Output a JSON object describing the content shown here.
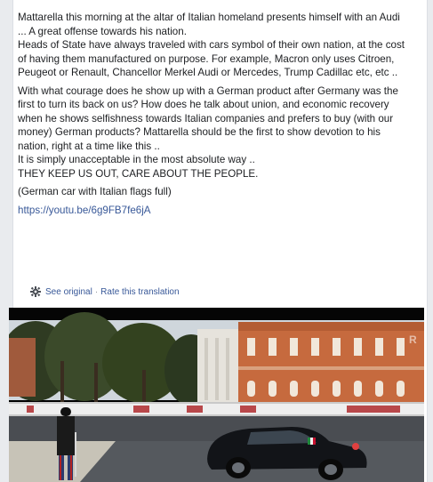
{
  "post": {
    "paragraphs": [
      "Mattarella this morning at the altar of Italian homeland presents himself with an Audi ... A great offense towards his nation.\nHeads of State have always traveled with cars symbol of their own nation, at the cost of having them manufactured on purpose. For example, Macron only uses Citroen, Peugeot or Renault, Chancellor Merkel Audi or Mercedes, Trump Cadillac etc, etc ..",
      "With what courage does he show up with a German product after Germany was the first to turn its back on us? How does he talk about union, and economic recovery when he shows selfishness towards Italian companies and prefers to buy (with our money) German products? Mattarella should be the first to show devotion to his nation, right at a time like this ..\nIt is simply unacceptable in the most absolute way ..\nTHEY KEEP US OUT, CARE ABOUT THE PEOPLE.",
      "(German car with Italian flags full)"
    ],
    "link": "https://youtu.be/6g9FB7fe6jA"
  },
  "translation": {
    "see_original": "See original",
    "separator": "·",
    "rate": "Rate this translation",
    "icon": "gear-icon"
  },
  "media": {
    "description_icon": "video-thumbnail",
    "colors": {
      "building": "#c66a3e",
      "sky": "#d9e0e6",
      "road": "#4a4d52",
      "car": "#121418"
    }
  }
}
